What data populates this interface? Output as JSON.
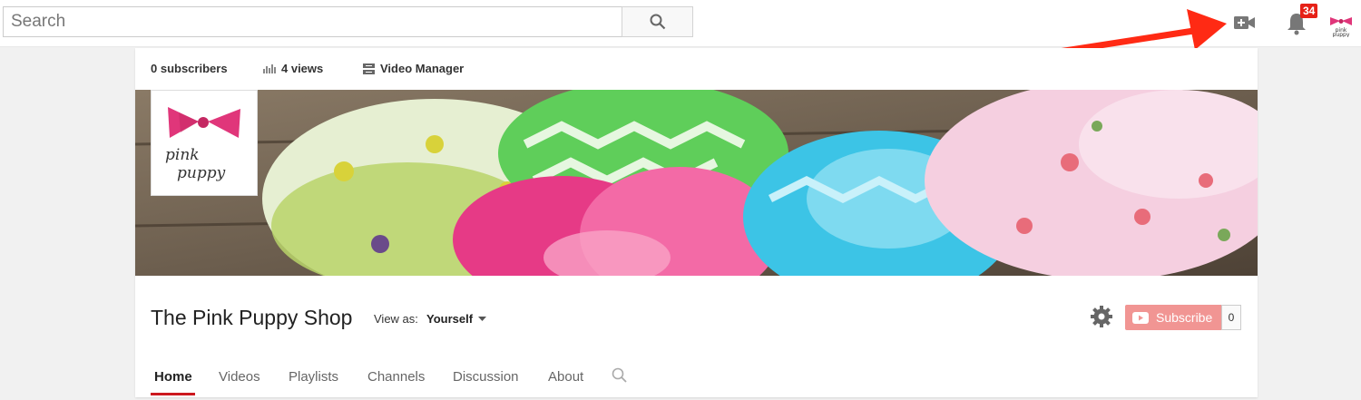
{
  "search": {
    "placeholder": "Search"
  },
  "topbar": {
    "notification_count": "34",
    "avatar_logo_text": "pink puppy"
  },
  "stats": {
    "subscribers": "0 subscribers",
    "views": "4 views",
    "video_manager": "Video Manager"
  },
  "channel": {
    "logo_text_line1": "pink",
    "logo_text_line2": "puppy",
    "title": "The Pink Puppy Shop",
    "view_as_label": "View as:",
    "view_as_value": "Yourself",
    "subscribe_label": "Subscribe",
    "subscriber_count": "0"
  },
  "tabs": [
    {
      "label": "Home",
      "active": true
    },
    {
      "label": "Videos"
    },
    {
      "label": "Playlists"
    },
    {
      "label": "Channels"
    },
    {
      "label": "Discussion"
    },
    {
      "label": "About"
    }
  ],
  "colors": {
    "accent": "#cc181e",
    "subscribe": "#f19593",
    "brand_pink": "#e0367a",
    "arrow": "#ff2a14"
  },
  "icons": [
    "search-icon",
    "upload-video-icon",
    "notification-bell-icon",
    "bar-chart-icon",
    "video-manager-icon",
    "gear-icon",
    "youtube-play-icon",
    "chevron-down-icon"
  ]
}
